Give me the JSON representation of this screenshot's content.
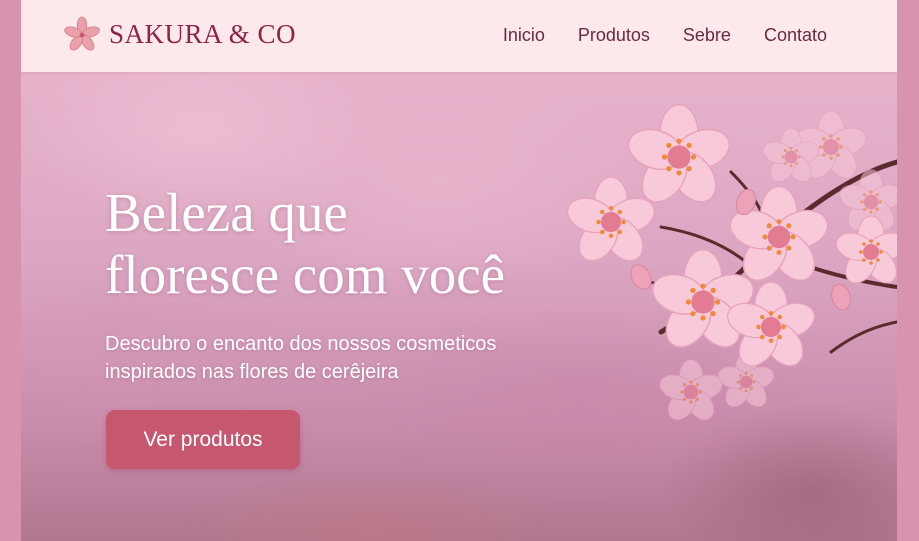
{
  "header": {
    "brand": "SAKURA & CO",
    "nav": [
      {
        "label": "Inicio"
      },
      {
        "label": "Produtos"
      },
      {
        "label": "Sebre"
      },
      {
        "label": "Contato"
      }
    ]
  },
  "hero": {
    "title_line1": "Beleza que",
    "title_line2": "floresce com você",
    "subtitle_line1": "Descubro o encanto dos nossos cosmeticos",
    "subtitle_line2": "inspirados nas flores de cerêjeira",
    "cta_label": "Ver produtos"
  },
  "icons": {
    "logo": "cherry-blossom-icon"
  },
  "colors": {
    "header_bg": "#fde8ec",
    "brand": "#8c2546",
    "nav_text": "#6a2a40",
    "cta_bg": "#c7566f",
    "page_bg": "#d893ae"
  }
}
